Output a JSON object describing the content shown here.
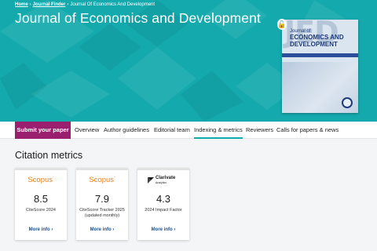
{
  "breadcrumb": {
    "items": [
      "Home",
      "Journal Finder",
      "Journal Of Economics And Development"
    ],
    "separator": "›"
  },
  "journal": {
    "title": "Journal of Economics and Development"
  },
  "cover": {
    "watermark": "JED",
    "journal_of": "Journal of",
    "title": "ECONOMICS AND DEVELOPMENT",
    "open_access_icon": "open-access-lock-icon"
  },
  "nav": {
    "submit_label": "Submit your paper",
    "items": [
      {
        "label": "Overview",
        "active": false
      },
      {
        "label": "Author guidelines",
        "active": false
      },
      {
        "label": "Editorial team",
        "active": false
      },
      {
        "label": "Indexing & metrics",
        "active": true
      },
      {
        "label": "Reviewers",
        "active": false
      },
      {
        "label": "Calls for papers & news",
        "active": false
      }
    ]
  },
  "metrics": {
    "section_title": "Citation metrics",
    "cards": [
      {
        "provider": "Scopus",
        "value": "8.5",
        "label": "CiteScore 2024",
        "label2": "",
        "link": "More info ›"
      },
      {
        "provider": "Scopus",
        "value": "7.9",
        "label": "CiteScore Tracker 2025",
        "label2": "(updated monthly)",
        "link": "More info ›"
      },
      {
        "provider": "Clarivate",
        "provider_sub": "Analytics",
        "value": "4.3",
        "label": "2024 Impact Factor",
        "label2": "",
        "link": "More info ›"
      }
    ]
  },
  "colors": {
    "hero": "#14a9ad",
    "submit": "#9b1f6f",
    "scopus": "#e8801c",
    "link": "#1d4f8a"
  }
}
